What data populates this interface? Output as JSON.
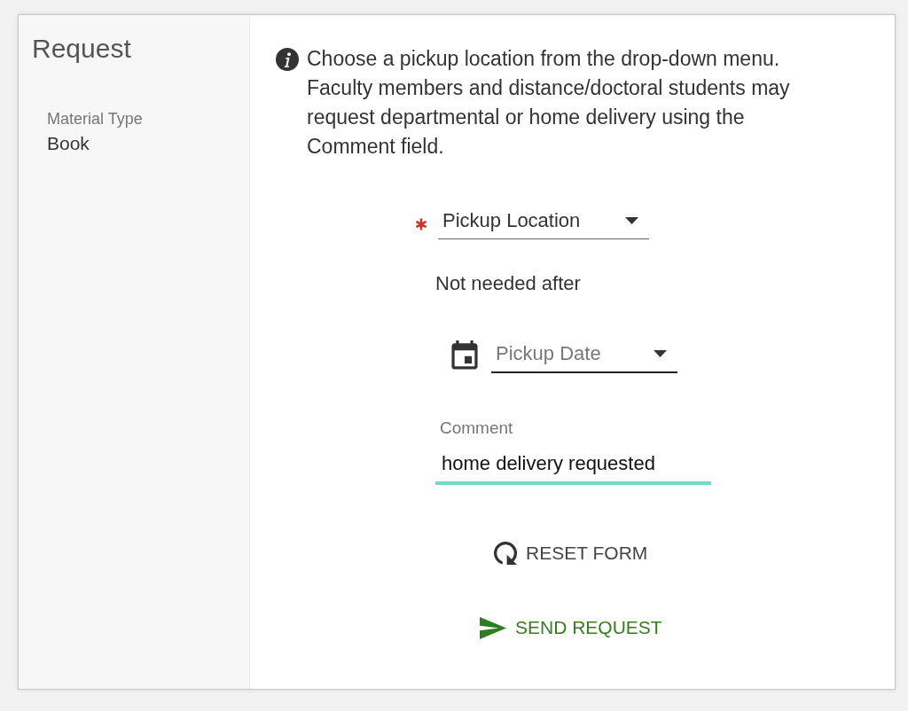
{
  "sidebar": {
    "title": "Request",
    "fields": [
      {
        "label": "Material Type",
        "value": "Book"
      }
    ]
  },
  "info": {
    "text": "Choose a pickup location from the drop-down menu. Faculty members and distance/doctoral students may request departmental or home delivery using the Comment field."
  },
  "form": {
    "pickup_location": {
      "label": "Pickup Location",
      "required": true
    },
    "not_needed_after": {
      "label": "Not needed after"
    },
    "pickup_date": {
      "placeholder": "Pickup Date"
    },
    "comment": {
      "label": "Comment",
      "value": "home delivery requested",
      "focused": true
    }
  },
  "buttons": [
    {
      "kind": "reset",
      "label": "RESET FORM"
    },
    {
      "kind": "send",
      "label": "SEND REQUEST"
    }
  ]
}
